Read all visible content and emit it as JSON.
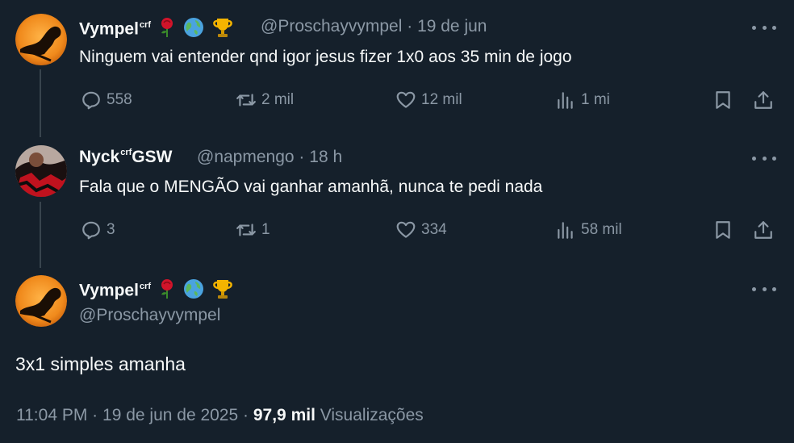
{
  "tweets": [
    {
      "name": "Vympel",
      "name_sup": "crf",
      "handle": "@Proschayvympel",
      "separator": "·",
      "date": "19 de jun",
      "text": "Ninguem vai entender qnd igor jesus fizer 1x0 aos 35 min de jogo",
      "actions": {
        "replies": "558",
        "retweets": "2 mil",
        "likes": "12 mil",
        "views": "1 mi"
      }
    },
    {
      "name": "Nyck",
      "name_sup": "crf",
      "name_suffix": "GSW",
      "handle": "@napmengo",
      "separator": "·",
      "date": "18 h",
      "text": "Fala que o MENGÃO vai ganhar amanhã, nunca te pedi nada",
      "actions": {
        "replies": "3",
        "retweets": "1",
        "likes": "334",
        "views": "58 mil"
      }
    }
  ],
  "main_tweet": {
    "name": "Vympel",
    "name_sup": "crf",
    "handle": "@Proschayvympel",
    "text": "3x1 simples amanha",
    "time": "11:04 PM",
    "separator": "·",
    "date": "19 de jun de 2025",
    "separator2": "·",
    "views_count": "97,9 mil",
    "views_label": "Visualizações"
  },
  "colors": {
    "background": "#15202b",
    "text": "#f7f9f9",
    "muted": "#8b98a5",
    "thread_line": "#38444d"
  }
}
